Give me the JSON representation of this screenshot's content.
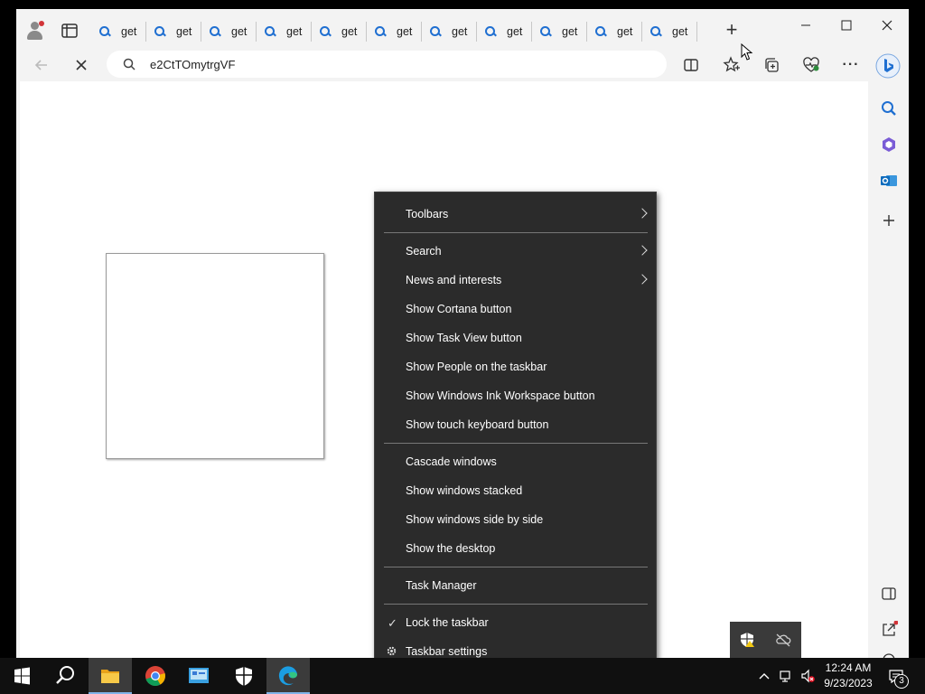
{
  "browser": {
    "tabs": [
      {
        "title": "get"
      },
      {
        "title": "get"
      },
      {
        "title": "get"
      },
      {
        "title": "get"
      },
      {
        "title": "get"
      },
      {
        "title": "get"
      },
      {
        "title": "get"
      },
      {
        "title": "get"
      },
      {
        "title": "get"
      },
      {
        "title": "get"
      },
      {
        "title": "get"
      }
    ],
    "tab_icon": "search-icon",
    "new_tab_label": "+",
    "address_text": "e2CtTOmytrgVF",
    "accent_color": "#1f6fd1"
  },
  "context_menu": {
    "items": [
      {
        "label": "Toolbars",
        "submenu": true
      },
      {
        "label": "Search",
        "submenu": true
      },
      {
        "label": "News and interests",
        "submenu": true
      },
      {
        "label": "Show Cortana button"
      },
      {
        "label": "Show Task View button"
      },
      {
        "label": "Show People on the taskbar"
      },
      {
        "label": "Show Windows Ink Workspace button"
      },
      {
        "label": "Show touch keyboard button"
      },
      {
        "label": "Cascade windows"
      },
      {
        "label": "Show windows stacked"
      },
      {
        "label": "Show windows side by side"
      },
      {
        "label": "Show the desktop"
      },
      {
        "label": "Task Manager"
      },
      {
        "label": "Lock the taskbar",
        "checked": true
      },
      {
        "label": "Taskbar settings",
        "icon": "gear-icon"
      }
    ],
    "check_glyph": "✓"
  },
  "taskbar": {
    "apps": [
      "start-icon",
      "search-icon",
      "file-explorer-icon",
      "chrome-icon",
      "control-panel-icon",
      "security-icon",
      "edge-icon"
    ],
    "clock": {
      "time": "12:24 AM",
      "date": "9/23/2023"
    },
    "notification_count": "3"
  }
}
